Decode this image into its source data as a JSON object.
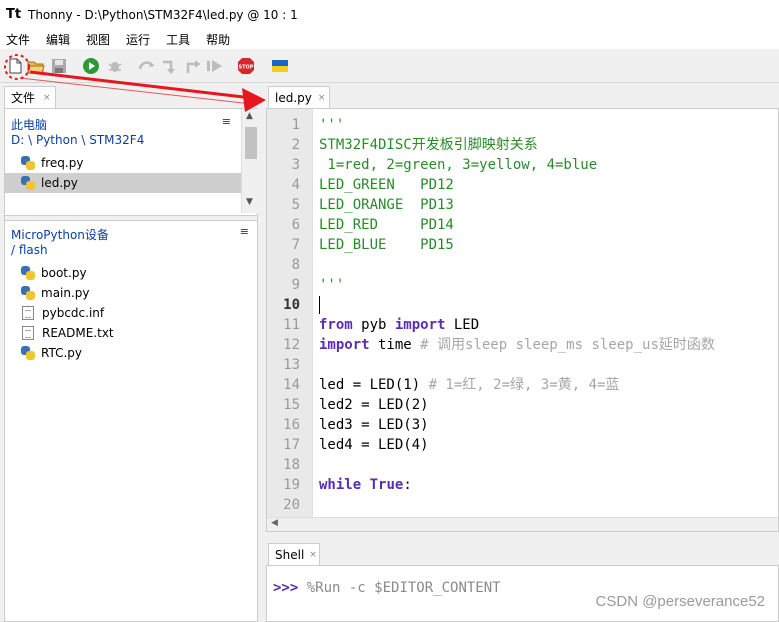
{
  "window": {
    "app_name": "Thonny",
    "title": "Thonny  -  D:\\Python\\STM32F4\\led.py  @  10 : 1"
  },
  "menu": [
    "文件",
    "编辑",
    "视图",
    "运行",
    "工具",
    "帮助"
  ],
  "toolbar": {
    "icons": [
      "new-file-icon",
      "open-file-icon",
      "save-icon",
      "run-icon",
      "debug-icon",
      "step-over-icon",
      "step-into-icon",
      "step-out-icon",
      "resume-icon",
      "stop-icon",
      "ukraine-flag-icon"
    ],
    "stop_label": "STOP"
  },
  "files_panel": {
    "tab_label": "文件",
    "tab_close": "×",
    "menu_glyph": "≡",
    "computer": {
      "heading": "此电脑",
      "path": "D: \\ Python \\ STM32F4",
      "files": [
        {
          "name": "freq.py",
          "type": "python",
          "selected": false
        },
        {
          "name": "led.py",
          "type": "python",
          "selected": true
        }
      ]
    },
    "device": {
      "heading": "MicroPython设备",
      "path": "/ flash",
      "files": [
        {
          "name": "boot.py",
          "type": "python"
        },
        {
          "name": "main.py",
          "type": "python"
        },
        {
          "name": "pybcdc.inf",
          "type": "text"
        },
        {
          "name": "README.txt",
          "type": "text"
        },
        {
          "name": "RTC.py",
          "type": "python"
        }
      ]
    }
  },
  "editor": {
    "tab_label": "led.py",
    "tab_close": "×",
    "current_line": 10,
    "lines": [
      {
        "n": "1",
        "parts": [
          {
            "t": "'''",
            "c": "str"
          }
        ]
      },
      {
        "n": "2",
        "parts": [
          {
            "t": "STM32F4DISC开发板引脚映射关系",
            "c": "str"
          }
        ]
      },
      {
        "n": "3",
        "parts": [
          {
            "t": " 1=red, 2=green, 3=yellow, 4=blue",
            "c": "str"
          }
        ]
      },
      {
        "n": "4",
        "parts": [
          {
            "t": "LED_GREEN   PD12",
            "c": "str"
          }
        ]
      },
      {
        "n": "5",
        "parts": [
          {
            "t": "LED_ORANGE  PD13",
            "c": "str"
          }
        ]
      },
      {
        "n": "6",
        "parts": [
          {
            "t": "LED_RED     PD14",
            "c": "str"
          }
        ]
      },
      {
        "n": "7",
        "parts": [
          {
            "t": "LED_BLUE    PD15",
            "c": "str"
          }
        ]
      },
      {
        "n": "8",
        "parts": []
      },
      {
        "n": "9",
        "parts": [
          {
            "t": "'''",
            "c": "str"
          }
        ]
      },
      {
        "n": "10",
        "parts": []
      },
      {
        "n": "11",
        "parts": [
          {
            "t": "from",
            "c": "kw"
          },
          {
            "t": " pyb ",
            "c": ""
          },
          {
            "t": "import",
            "c": "kw"
          },
          {
            "t": " LED",
            "c": ""
          }
        ]
      },
      {
        "n": "12",
        "parts": [
          {
            "t": "import",
            "c": "kw"
          },
          {
            "t": " time ",
            "c": ""
          },
          {
            "t": "# 调用sleep sleep_ms sleep_us延时函数",
            "c": "cm"
          }
        ]
      },
      {
        "n": "13",
        "parts": []
      },
      {
        "n": "14",
        "parts": [
          {
            "t": "led = LED(1) ",
            "c": ""
          },
          {
            "t": "# 1=红, 2=绿, 3=黄, 4=蓝",
            "c": "cm"
          }
        ]
      },
      {
        "n": "15",
        "parts": [
          {
            "t": "led2 = LED(2)",
            "c": ""
          }
        ]
      },
      {
        "n": "16",
        "parts": [
          {
            "t": "led3 = LED(3)",
            "c": ""
          }
        ]
      },
      {
        "n": "17",
        "parts": [
          {
            "t": "led4 = LED(4)",
            "c": ""
          }
        ]
      },
      {
        "n": "18",
        "parts": []
      },
      {
        "n": "19",
        "parts": [
          {
            "t": "while",
            "c": "kw"
          },
          {
            "t": " ",
            "c": ""
          },
          {
            "t": "True",
            "c": "kw"
          },
          {
            "t": ":",
            "c": ""
          }
        ]
      },
      {
        "n": "20",
        "parts": []
      }
    ]
  },
  "shell": {
    "tab_label": "Shell",
    "tab_close": "×",
    "prompt": ">>>",
    "command": " %Run -c $EDITOR_CONTENT"
  },
  "watermark": "CSDN @perseverance52",
  "colors": {
    "arrow": "#e8141e",
    "string": "#2a8a2a",
    "keyword": "#5a2bb3",
    "comment": "#a6a6a6",
    "link": "#0b3ea5"
  }
}
